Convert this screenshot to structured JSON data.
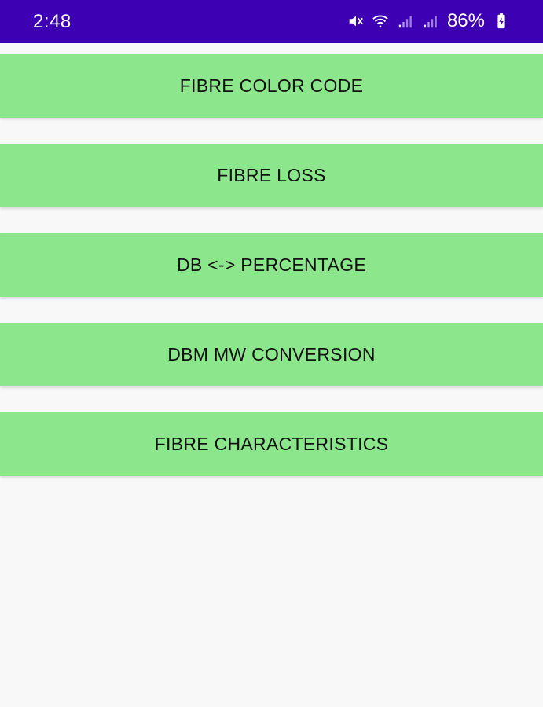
{
  "status_bar": {
    "time": "2:48",
    "battery_percent": "86%",
    "icons": [
      "mute-icon",
      "wifi-icon",
      "signal-icon",
      "signal-icon",
      "battery-icon"
    ],
    "background": "#3e00b3"
  },
  "menu": {
    "button_color": "#8ce68c",
    "items": [
      {
        "label": "FIBRE COLOR CODE"
      },
      {
        "label": "FIBRE LOSS"
      },
      {
        "label": "DB <-> PERCENTAGE"
      },
      {
        "label": "DBM MW CONVERSION"
      },
      {
        "label": "FIBRE CHARACTERISTICS"
      }
    ]
  }
}
